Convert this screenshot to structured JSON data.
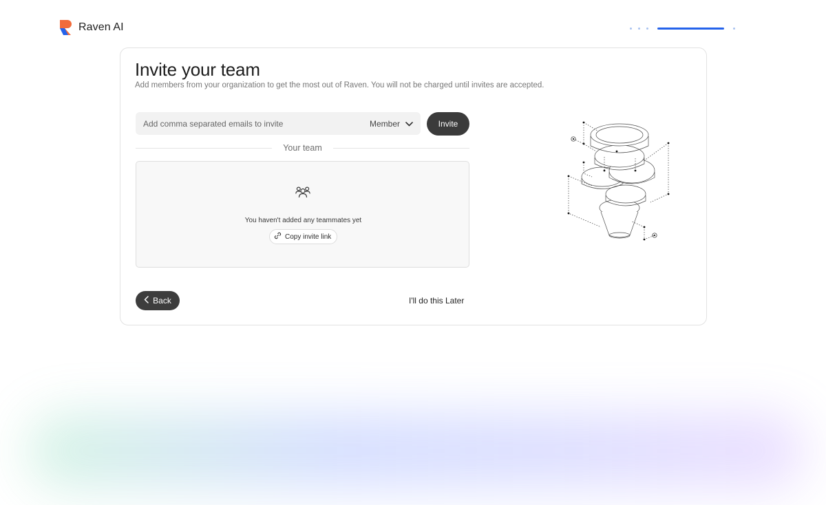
{
  "brand": {
    "name": "Raven AI",
    "logo_colors": [
      "#f26b3a",
      "#2563eb"
    ]
  },
  "progress": {
    "total_steps": 5,
    "current_step": 4,
    "active_color": "#2563eb"
  },
  "page": {
    "title": "Invite your team",
    "subtitle": "Add members from your organization to get the most out of Raven. You will not be charged until invites are accepted."
  },
  "invite": {
    "email_placeholder": "Add comma separated emails to invite",
    "email_value": "",
    "role_selected": "Member",
    "invite_label": "Invite"
  },
  "team": {
    "section_label": "Your team",
    "empty_text": "You haven't added any teammates yet",
    "copy_link_label": "Copy invite link",
    "icon": "users-icon"
  },
  "footer": {
    "back_label": "Back",
    "later_label": "I'll do this Later"
  },
  "colors": {
    "primary_button": "#3b3b3b",
    "accent": "#2563eb"
  }
}
